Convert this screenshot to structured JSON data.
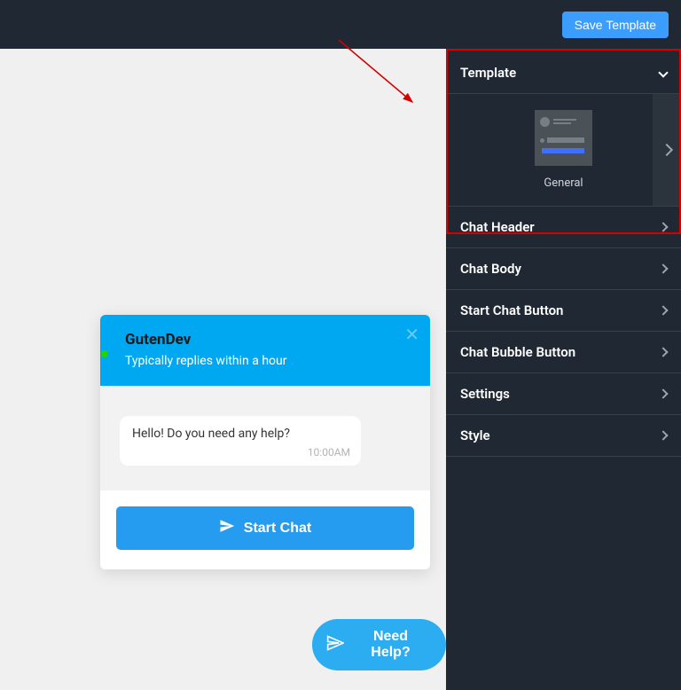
{
  "topBar": {
    "saveLabel": "Save Template"
  },
  "chat": {
    "title": "GutenDev",
    "subtitle": "Typically replies within a hour",
    "message": "Hello! Do you need any help?",
    "time": "10:00AM",
    "startChatLabel": "Start Chat",
    "bubbleLabel": "Need Help?"
  },
  "sidebar": {
    "templateHeader": "Template",
    "templateName": "General",
    "sections": {
      "chatHeader": "Chat Header",
      "chatBody": "Chat Body",
      "startChatButton": "Start Chat Button",
      "chatBubbleButton": "Chat Bubble Button",
      "settings": "Settings",
      "style": "Style"
    }
  }
}
